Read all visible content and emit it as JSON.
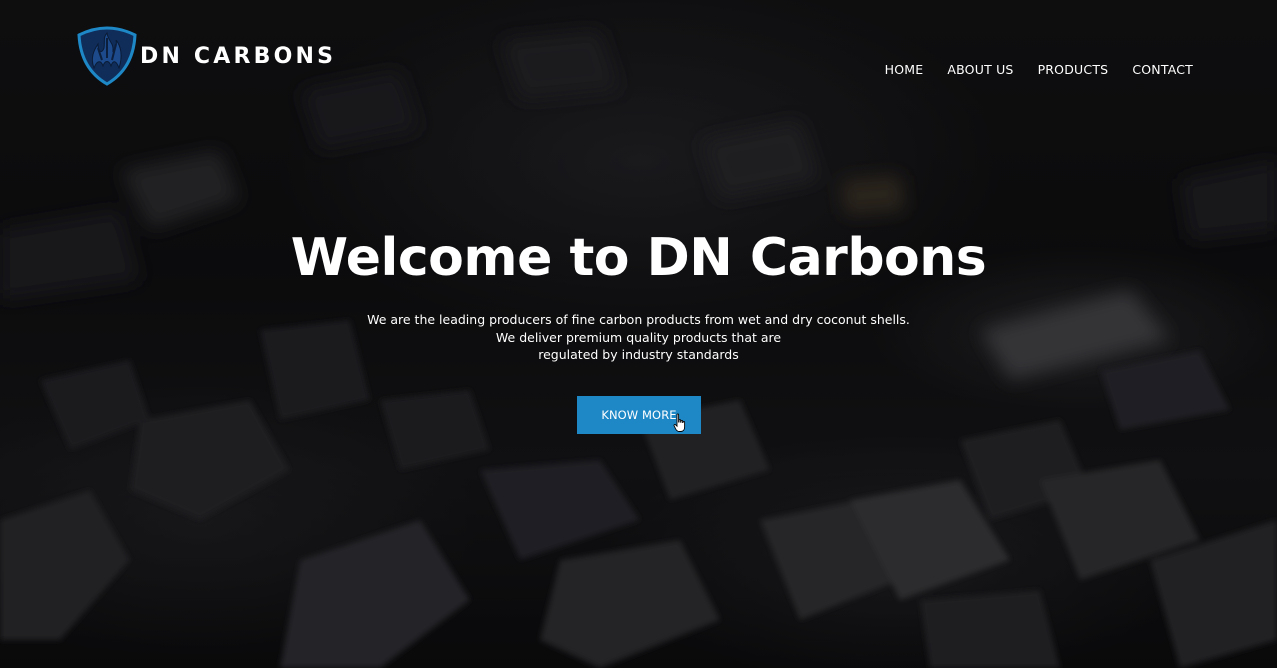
{
  "brand": {
    "name": "DN CARBONS",
    "logo_icon": "shield-flame-icon",
    "accent_color": "#1e88c7"
  },
  "nav": {
    "items": [
      {
        "label": "HOME"
      },
      {
        "label": "ABOUT US"
      },
      {
        "label": "PRODUCTS"
      },
      {
        "label": "CONTACT"
      }
    ]
  },
  "hero": {
    "title": "Welcome to DN Carbons",
    "tagline_lines": [
      "We are the leading producers of fine carbon products from wet and dry coconut shells.",
      "We deliver premium quality products that are",
      "regulated by industry standards"
    ],
    "cta_label": "KNOW MORE",
    "cta_color": "#1e88c7",
    "cursor_icon": "hand-pointer-icon"
  }
}
